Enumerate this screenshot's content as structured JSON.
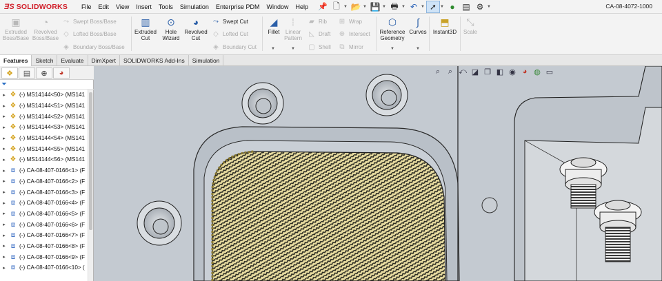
{
  "app": {
    "logo_ds": "ƎS",
    "logo_brand": "SOLIDWORKS",
    "document_name": "CA-08-4072-1000"
  },
  "menu": [
    "File",
    "Edit",
    "View",
    "Insert",
    "Tools",
    "Simulation",
    "Enterprise PDM",
    "Window",
    "Help"
  ],
  "quick_access_icons": [
    "new-document-icon",
    "open-icon",
    "save-icon",
    "print-icon",
    "undo-icon",
    "select-icon",
    "rebuild-icon",
    "file-properties-icon",
    "options-icon"
  ],
  "ribbon": {
    "extruded_boss": "Extruded Boss/Base",
    "revolved_boss": "Revolved Boss/Base",
    "swept_boss": "Swept Boss/Base",
    "lofted_boss": "Lofted Boss/Base",
    "boundary_boss": "Boundary Boss/Base",
    "extruded_cut": "Extruded Cut",
    "hole_wizard": "Hole Wizard",
    "revolved_cut": "Revolved Cut",
    "swept_cut": "Swept Cut",
    "lofted_cut": "Lofted Cut",
    "boundary_cut": "Boundary Cut",
    "fillet": "Fillet",
    "linear_pattern": "Linear Pattern",
    "rib": "Rib",
    "draft": "Draft",
    "shell": "Shell",
    "wrap": "Wrap",
    "intersect": "Intersect",
    "mirror": "Mirror",
    "reference_geometry": "Reference Geometry",
    "curves": "Curves",
    "instant3d": "Instant3D",
    "scale": "Scale"
  },
  "tabs": [
    {
      "label": "Features",
      "active": true
    },
    {
      "label": "Sketch",
      "active": false
    },
    {
      "label": "Evaluate",
      "active": false
    },
    {
      "label": "DimXpert",
      "active": false
    },
    {
      "label": "SOLIDWORKS Add-Ins",
      "active": false
    },
    {
      "label": "Simulation",
      "active": false
    }
  ],
  "feature_manager": {
    "panel_tabs": [
      "featuremanager-tab",
      "propertymanager-tab",
      "configurationmanager-tab",
      "appearance-tab"
    ],
    "tree": [
      {
        "label": "(-) MS14144<50> (MS141",
        "type": "part"
      },
      {
        "label": "(-) MS14144<51> (MS141",
        "type": "part"
      },
      {
        "label": "(-) MS14144<52> (MS141",
        "type": "part"
      },
      {
        "label": "(-) MS14144<53> (MS141",
        "type": "part"
      },
      {
        "label": "(-) MS14144<54> (MS141",
        "type": "part"
      },
      {
        "label": "(-) MS14144<55> (MS141",
        "type": "part"
      },
      {
        "label": "(-) MS14144<56> (MS141",
        "type": "part"
      },
      {
        "label": "(-) CA-08-407-0166<1> (F",
        "type": "asm"
      },
      {
        "label": "(-) CA-08-407-0166<2> (F",
        "type": "asm"
      },
      {
        "label": "(-) CA-08-407-0166<3> (F",
        "type": "asm"
      },
      {
        "label": "(-) CA-08-407-0166<4> (F",
        "type": "asm"
      },
      {
        "label": "(-) CA-08-407-0166<5> (F",
        "type": "asm"
      },
      {
        "label": "(-) CA-08-407-0166<6> (F",
        "type": "asm"
      },
      {
        "label": "(-) CA-08-407-0166<7> (F",
        "type": "asm"
      },
      {
        "label": "(-) CA-08-407-0166<8> (F",
        "type": "asm"
      },
      {
        "label": "(-) CA-08-407-0166<9> (F",
        "type": "asm"
      },
      {
        "label": "(-) CA-08-407-0166<10> (",
        "type": "asm"
      }
    ]
  },
  "heads_up_toolbar": [
    "zoom-to-fit-icon",
    "zoom-area-icon",
    "previous-view-icon",
    "section-view-icon",
    "view-orientation-icon",
    "display-style-icon",
    "hide-show-icon",
    "edit-appearance-icon",
    "apply-scene-icon",
    "view-settings-icon"
  ],
  "colors": {
    "ribbon_bg": "#f3f3f3",
    "viewport_bg": "#c4cad1",
    "brand_red": "#d11f2a",
    "part_icon": "#d4a21c",
    "asm_icon": "#4a79c8"
  }
}
